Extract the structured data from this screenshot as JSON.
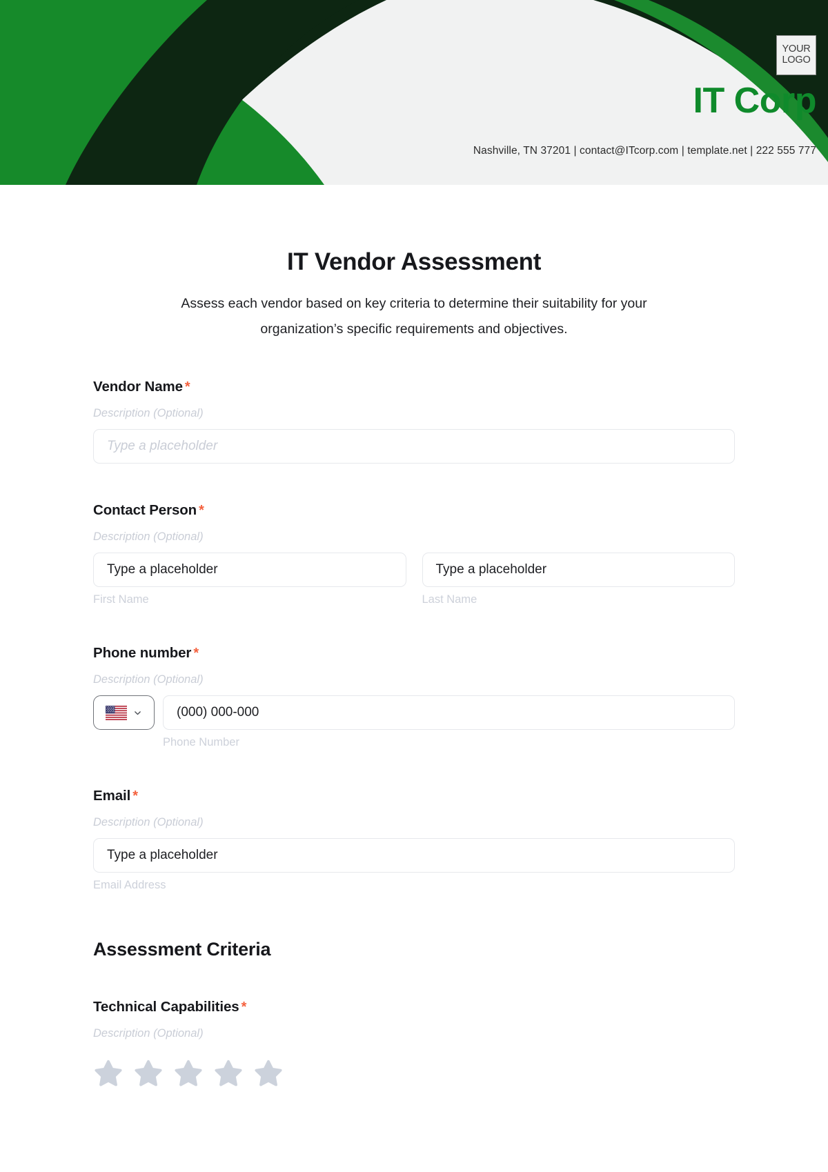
{
  "header": {
    "logo_line1": "YOUR",
    "logo_line2": "LOGO",
    "brand_name": "IT Corp",
    "contact_line": "Nashville, TN 37201 | contact@ITcorp.com | template.net | 222 555 777",
    "brand_color": "#0f8a2b",
    "dark_green": "#0d2612",
    "band_bg": "#f1f2f2"
  },
  "form": {
    "title": "IT Vendor Assessment",
    "subtitle": "Assess each vendor based on key criteria to determine their suitability for your organization’s specific requirements and objectives.",
    "required_marker": "*",
    "description_placeholder": "Description (Optional)",
    "fields": {
      "vendor_name": {
        "label": "Vendor Name",
        "description": "Description (Optional)",
        "placeholder": "Type a placeholder"
      },
      "contact_person": {
        "label": "Contact Person",
        "description": "Description (Optional)",
        "first_value": "Type a placeholder",
        "first_sub_label": "First Name",
        "last_value": "Type a placeholder",
        "last_sub_label": "Last Name"
      },
      "phone_number": {
        "label": "Phone number",
        "description": "Description (Optional)",
        "country_flag": "us-flag-icon",
        "dropdown_icon": "chevron-down-icon",
        "value": "(000) 000-000",
        "sub_label": "Phone Number"
      },
      "email": {
        "label": "Email",
        "description": "Description (Optional)",
        "value": "Type a placeholder",
        "sub_label": "Email Address"
      }
    },
    "assessment": {
      "heading": "Assessment Criteria",
      "technical_capabilities": {
        "label": "Technical Capabilities",
        "description": "Description (Optional)",
        "rating_max": 5,
        "rating_value": 0,
        "star_color": "#ccd2dc"
      }
    }
  }
}
